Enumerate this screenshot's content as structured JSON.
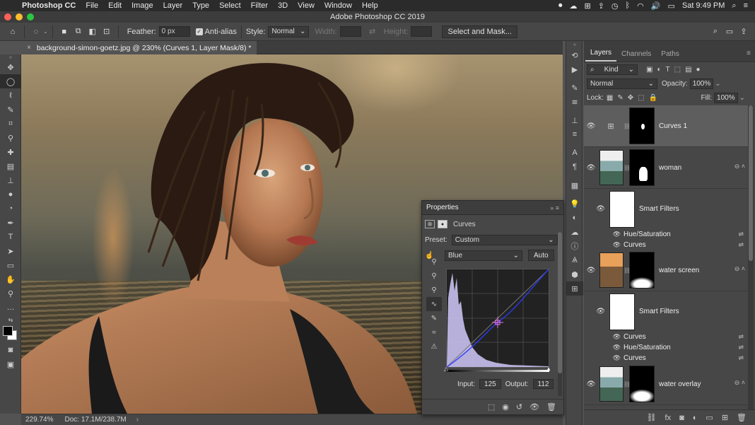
{
  "menubar": {
    "app_name": "Photoshop CC",
    "items": [
      "File",
      "Edit",
      "Image",
      "Layer",
      "Type",
      "Select",
      "Filter",
      "3D",
      "View",
      "Window",
      "Help"
    ],
    "clock": "Sat 9:49 PM",
    "battery": "▮"
  },
  "window": {
    "title": "Adobe Photoshop CC 2019",
    "traffic_colors": [
      "#fe5f57",
      "#febc2e",
      "#28c840"
    ]
  },
  "options": {
    "feather_label": "Feather:",
    "feather_value": "0 px",
    "antialias_label": "Anti-alias",
    "style_label": "Style:",
    "style_value": "Normal",
    "width_label": "Width:",
    "height_label": "Height:",
    "select_mask_label": "Select and Mask..."
  },
  "document": {
    "tab_title": "background-simon-goetz.jpg @ 230% (Curves 1, Layer Mask/8) *",
    "zoom": "229.74%",
    "doc_info": "Doc: 17.1M/238.7M"
  },
  "tools": [
    "move-tool",
    "marquee-tool",
    "lasso-tool",
    "quick-select-tool",
    "crop-tool",
    "eyedropper-tool",
    "healing-tool",
    "brush-tool",
    "clone-stamp-tool",
    "history-brush-tool",
    "eraser-tool",
    "gradient-tool",
    "blur-tool",
    "dodge-tool",
    "pen-tool",
    "type-tool",
    "path-select-tool",
    "shape-tool",
    "hand-tool",
    "zoom-tool",
    "more-tools"
  ],
  "layers_panel": {
    "tabs": [
      "Layers",
      "Channels",
      "Paths"
    ],
    "kind_label": "Kind",
    "blend_mode": "Normal",
    "opacity_label": "Opacity:",
    "opacity_value": "100%",
    "lock_label": "Lock:",
    "fill_label": "Fill:",
    "fill_value": "100%",
    "layers": [
      {
        "name": "Curves 1"
      },
      {
        "name": "woman",
        "smart_filters": "Smart Filters",
        "filters": [
          "Hue/Saturation",
          "Curves"
        ]
      },
      {
        "name": "water screen",
        "smart_filters": "Smart Filters",
        "filters": [
          "Curves",
          "Hue/Saturation",
          "Curves"
        ]
      },
      {
        "name": "water overlay"
      }
    ]
  },
  "properties": {
    "title": "Properties",
    "adjustment": "Curves",
    "preset_label": "Preset:",
    "preset_value": "Custom",
    "channel_value": "Blue",
    "auto_label": "Auto",
    "input_label": "Input:",
    "input_value": "125",
    "output_label": "Output:",
    "output_value": "112"
  }
}
